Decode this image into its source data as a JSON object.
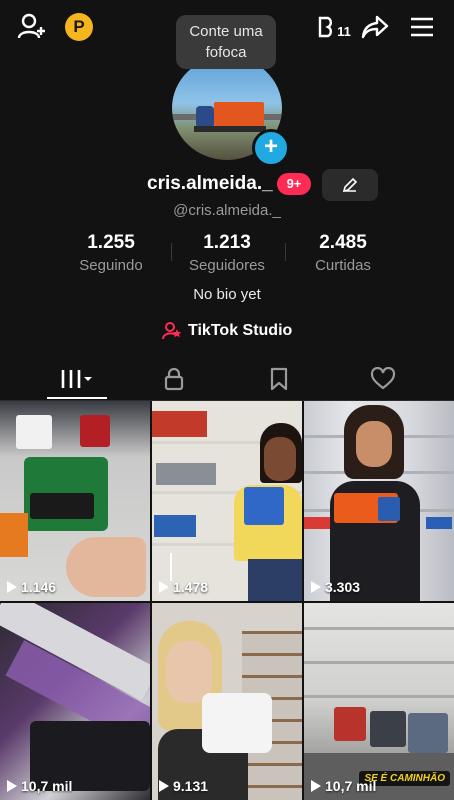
{
  "header": {
    "coin_label": "P",
    "tooltip": "Conte uma fofoca",
    "activity_count": "11"
  },
  "profile": {
    "display_name": "cris.almeida._",
    "notification_badge": "9+",
    "username": "@cris.almeida._",
    "bio": "No bio yet",
    "studio_label": "TikTok Studio"
  },
  "stats": [
    {
      "value": "1.255",
      "label": "Seguindo"
    },
    {
      "value": "1.213",
      "label": "Seguidores"
    },
    {
      "value": "2.485",
      "label": "Curtidas"
    }
  ],
  "tabs": [
    "videos-tab",
    "private-tab",
    "saved-tab",
    "liked-tab"
  ],
  "videos": [
    {
      "views": "1.146"
    },
    {
      "views": "1.478"
    },
    {
      "views": "3.303"
    },
    {
      "views": "10,7 mil"
    },
    {
      "views": "9.131"
    },
    {
      "views": "10,7 mil",
      "caption": "SE É CAMINHÃO"
    }
  ],
  "colors": {
    "accent": "#fe2c55",
    "coin": "#f5b51e",
    "add": "#21a9e1"
  }
}
